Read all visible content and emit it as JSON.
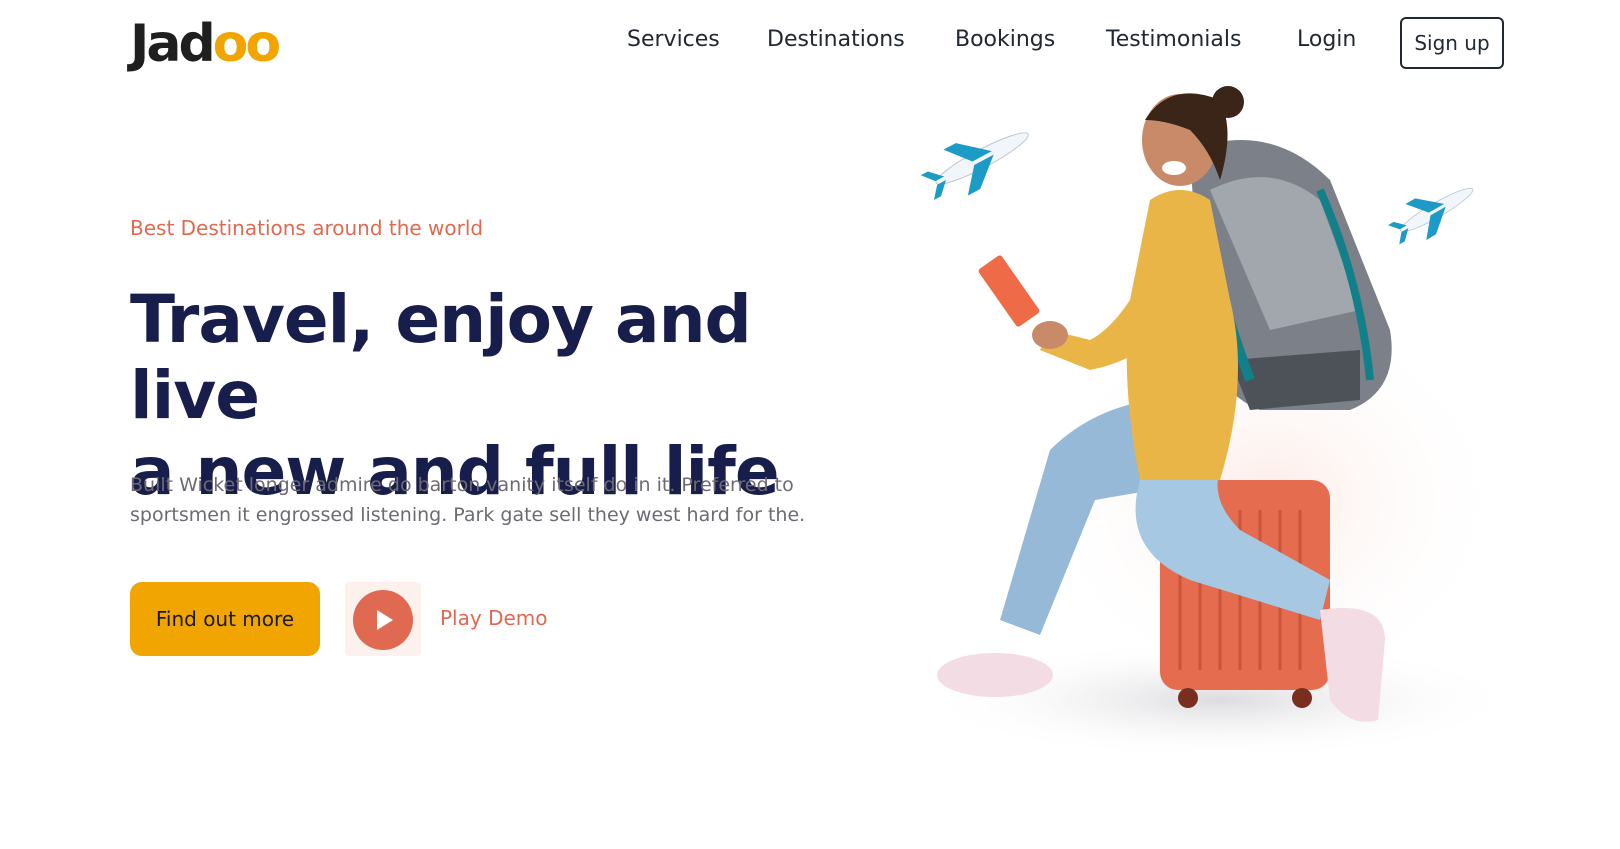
{
  "brand": {
    "logo_text": "Jadoo"
  },
  "nav": {
    "links": [
      "Services",
      "Destinations",
      "Bookings",
      "Testimonials"
    ],
    "login_label": "Login",
    "signup_label": "Sign up"
  },
  "hero": {
    "tagline": "Best Destinations around the world",
    "headline_line1": "Travel, enjoy and live",
    "headline_line2": "a new and full life",
    "description": "Built Wicket longer admire do barton vanity itself do in it. Preferred to sportsmen it engrossed listening. Park gate sell they west hard for the.",
    "cta_label": "Find out more",
    "play_label": "Play Demo",
    "play_icon": "play-icon",
    "image_subject": "traveler-with-backpack-on-suitcase"
  },
  "colors": {
    "accent_yellow": "#f1a501",
    "accent_coral": "#df6951",
    "heading_navy": "#181e4b",
    "body_gray": "#6e6a72",
    "nav_text": "#212832"
  }
}
